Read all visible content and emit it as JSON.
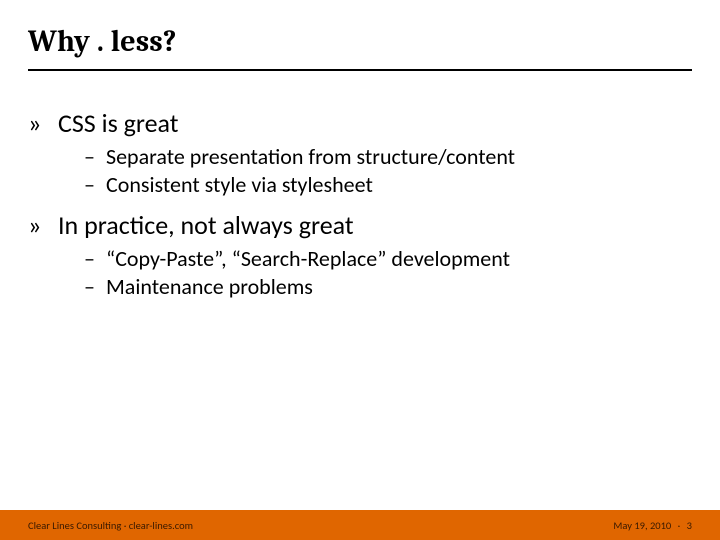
{
  "slide": {
    "title": "Why . less?",
    "bullets": [
      {
        "marker": "»",
        "text": "CSS is great",
        "sub": [
          {
            "dash": "–",
            "text": "Separate presentation from structure/content"
          },
          {
            "dash": "–",
            "text": "Consistent style via stylesheet"
          }
        ]
      },
      {
        "marker": "»",
        "text": "In practice, not always great",
        "sub": [
          {
            "dash": "–",
            "text": "“Copy-Paste”, “Search-Replace” development"
          },
          {
            "dash": "–",
            "text": "Maintenance problems"
          }
        ]
      }
    ]
  },
  "footer": {
    "left": "Clear Lines Consulting · clear-lines.com",
    "date": "May 19, 2010",
    "separator": "·",
    "page": "3"
  },
  "colors": {
    "accent": "#e06600"
  }
}
